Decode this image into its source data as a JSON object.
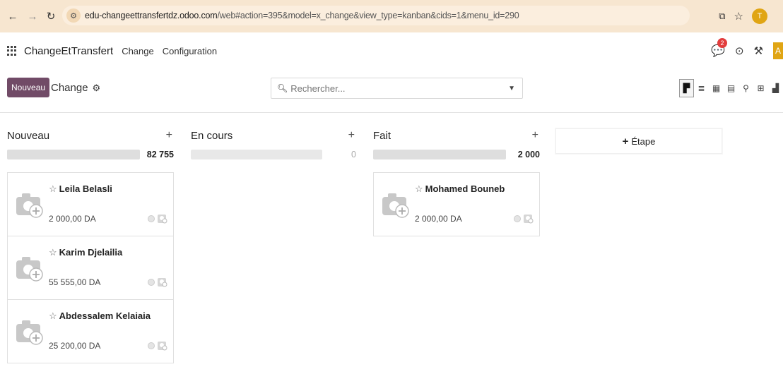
{
  "browser": {
    "url_domain": "edu-changeettransfertdz.odoo.com",
    "url_path": "/web#action=395&model=x_change&view_type=kanban&cids=1&menu_id=290",
    "profile_initial": "T"
  },
  "navbar": {
    "app_name": "ChangeEtTransfert",
    "menu": [
      "Change",
      "Configuration"
    ],
    "chat_badge": "2",
    "avatar_initial": "A"
  },
  "control": {
    "new_label": "Nouveau",
    "breadcrumb": "Change",
    "search_placeholder": "Rechercher..."
  },
  "columns": [
    {
      "title": "Nouveau",
      "total": "82 755",
      "cards": [
        {
          "name": "Leila Belasli",
          "amount": "2 000,00 DA"
        },
        {
          "name": "Karim Djelailia",
          "amount": "55 555,00 DA"
        },
        {
          "name": "Abdessalem Kelaiaia",
          "amount": "25 200,00 DA"
        }
      ]
    },
    {
      "title": "En cours",
      "total": "0",
      "cards": []
    },
    {
      "title": "Fait",
      "total": "2 000",
      "cards": [
        {
          "name": "Mohamed Bouneb",
          "amount": "2 000,00 DA"
        }
      ]
    }
  ],
  "add_stage_label": "Étape",
  "colors": {
    "primary": "#714b67",
    "chrome": "#f7e6d0",
    "badge": "#e23d3d"
  }
}
